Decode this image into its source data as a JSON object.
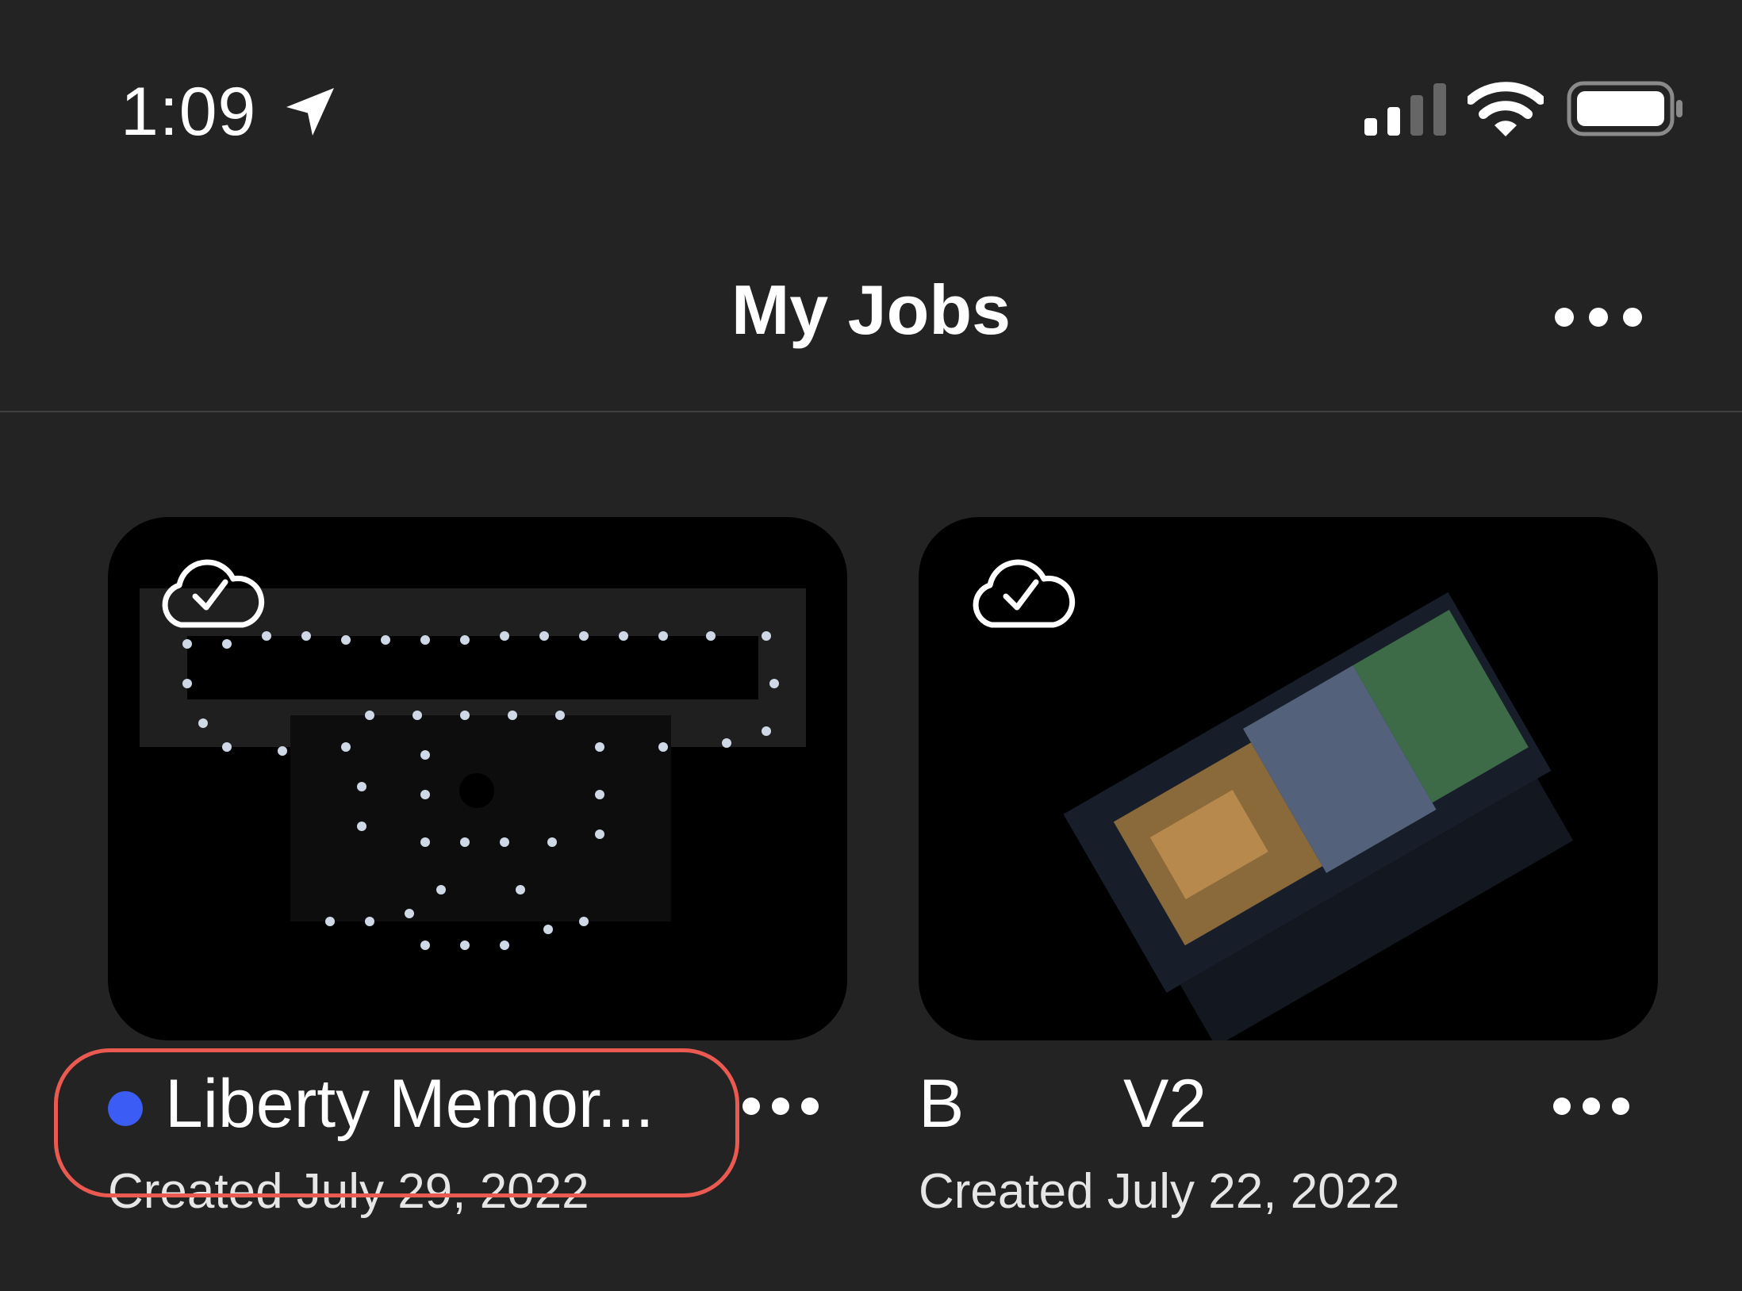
{
  "status_bar": {
    "time": "1:09",
    "icons": [
      "location-arrow-icon",
      "cellular-signal-icon",
      "wifi-icon",
      "battery-icon"
    ]
  },
  "header": {
    "title": "My Jobs",
    "more_icon": "more-icon"
  },
  "jobs": [
    {
      "name": "Liberty Memor...",
      "created": "Created July 29, 2022",
      "sync_icon": "cloud-check-icon",
      "unread_indicator_color": "#3b5cf5",
      "highlighted": true
    },
    {
      "name_part1": "B",
      "name_part2": "V2",
      "created": "Created July 22, 2022",
      "sync_icon": "cloud-check-icon"
    }
  ],
  "colors": {
    "background": "#232323",
    "highlight_border": "#ea5a50",
    "accent_dot": "#3b5cf5"
  }
}
